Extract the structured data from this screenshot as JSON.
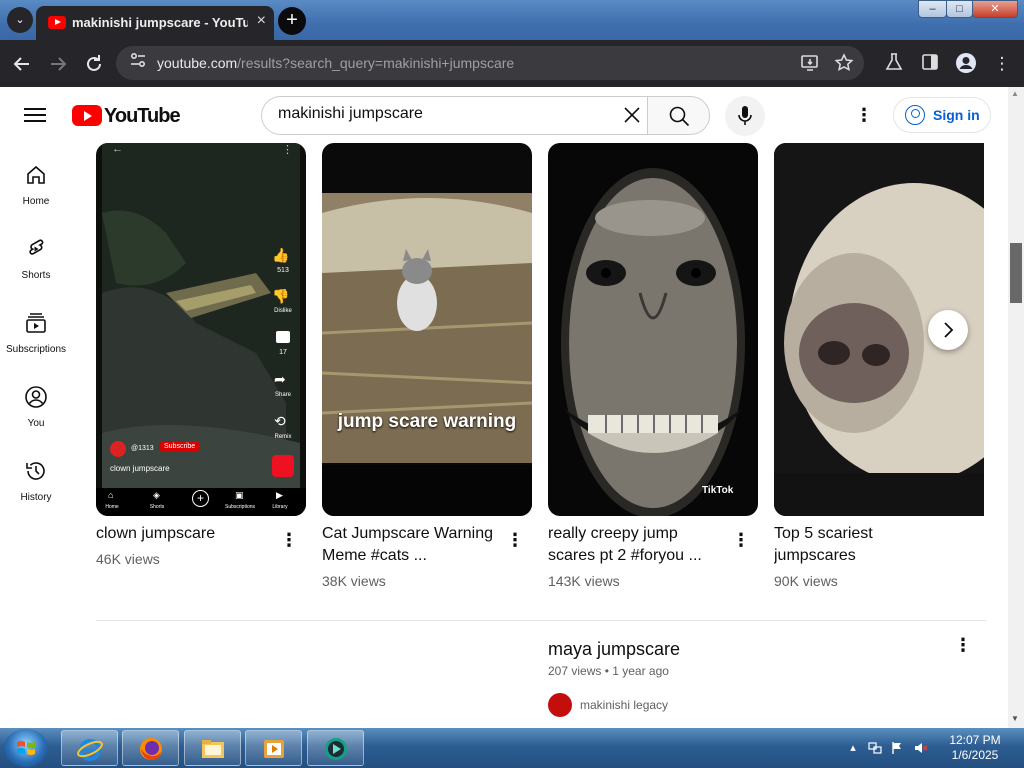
{
  "browser": {
    "tab_title": "makinishi jumpscare - YouTube",
    "tab_close": "×",
    "new_tab": "+",
    "url_host": "youtube.com",
    "url_rest": "/results?search_query=makinishi+jumpscare",
    "window_buttons": {
      "minimize": "–",
      "maximize": "□",
      "close": "✕"
    }
  },
  "youtube": {
    "logo_text": "YouTube",
    "search_value": "makinishi jumpscare",
    "signin_label": "Sign in",
    "guide": [
      {
        "label": "Home",
        "icon": "home-icon"
      },
      {
        "label": "Shorts",
        "icon": "shorts-icon"
      },
      {
        "label": "Subscriptions",
        "icon": "subscriptions-icon"
      },
      {
        "label": "You",
        "icon": "you-icon"
      },
      {
        "label": "History",
        "icon": "history-icon"
      }
    ],
    "shorts": [
      {
        "title": "clown jumpscare",
        "views": "46K views"
      },
      {
        "title": "Cat Jumpscare Warning Meme #cats ...",
        "views": "38K views",
        "overlay": "jump scare warning"
      },
      {
        "title": "really creepy jump scares pt 2 #foryou ...",
        "views": "143K views",
        "overlay": "TikTok"
      },
      {
        "title": "Top 5 scariest jumpscares",
        "views": "90K views"
      }
    ],
    "short1_overlay": {
      "likes": "513",
      "like_label": "",
      "dislike_label": "Dislike",
      "comments": "17",
      "share_label": "Share",
      "remix_label": "Remix",
      "channel": "@1313",
      "subscribe": "Subscribe",
      "caption": "clown jumpscare",
      "nav": [
        "Home",
        "Shorts",
        "",
        "Subscriptions",
        "Library"
      ]
    },
    "video": {
      "title": "maya jumpscare",
      "meta": "207 views • 1 year ago",
      "channel": "makinishi legacy"
    }
  },
  "taskbar": {
    "time": "12:07 PM",
    "date": "1/6/2025",
    "apps": [
      "internet-explorer-icon",
      "firefox-icon",
      "file-explorer-icon",
      "media-player-icon",
      "chrome-like-icon"
    ]
  }
}
